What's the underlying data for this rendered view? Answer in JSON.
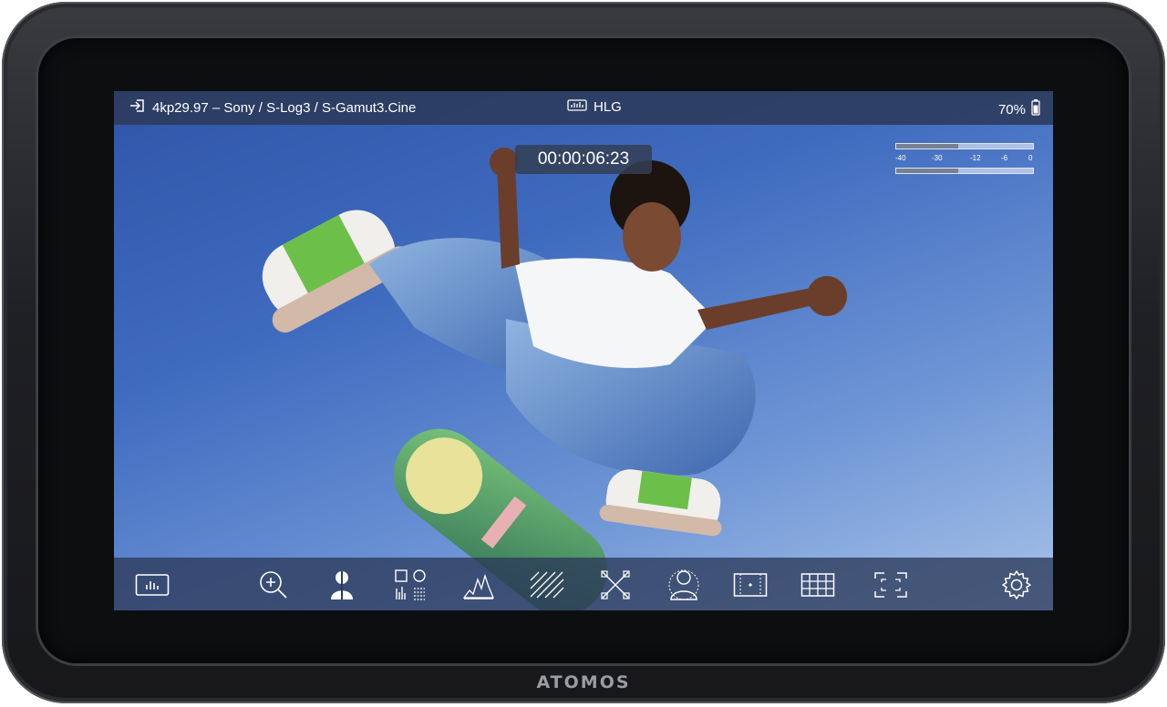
{
  "device": {
    "brand": "ATOMOS"
  },
  "status_bar": {
    "input_format": "4kp29.97 – Sony / S-Log3 / S-Gamut3.Cine",
    "output_mode": "HLG",
    "battery": "70%"
  },
  "timecode": "00:00:06:23",
  "audio_meters": {
    "scale": [
      "-40",
      "-30",
      "-12",
      "-6",
      "0"
    ],
    "channels": [
      0.45,
      0.45
    ]
  },
  "toolbar": {
    "items": [
      "scopes",
      "zoom",
      "false-color",
      "waveform-panels",
      "histogram",
      "zebra",
      "focus-peaking",
      "skin-tone",
      "frame-guides",
      "grid",
      "safe-area",
      "settings"
    ]
  },
  "colors": {
    "bar_bg": "#2c3a5a",
    "sky_top": "#2f55a8",
    "sky_bottom": "#a9c3e8",
    "accent_green": "#6cc04a"
  }
}
